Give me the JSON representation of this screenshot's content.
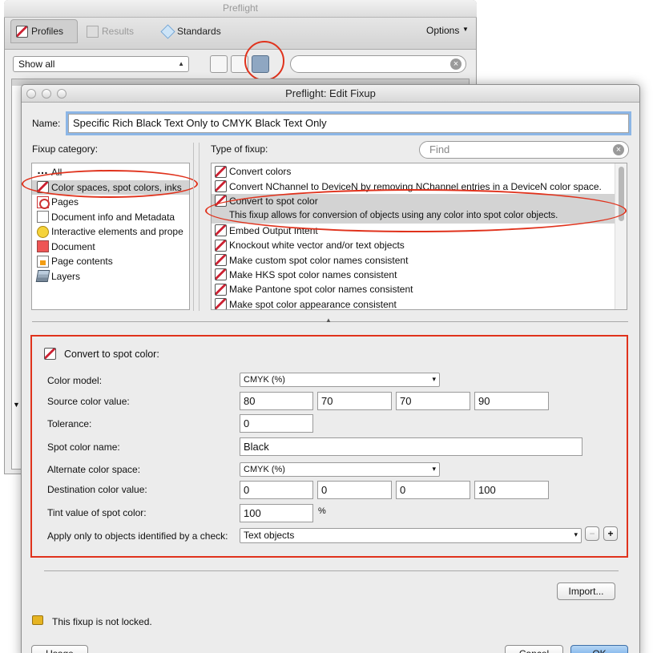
{
  "background_window": {
    "title": "Preflight",
    "tabs": [
      {
        "label": "Profiles",
        "icon": "profiles-icon",
        "selected": true
      },
      {
        "label": "Results",
        "icon": "results-icon",
        "selected": false
      },
      {
        "label": "Standards",
        "icon": "standards-icon",
        "selected": false
      }
    ],
    "options_label": "Options",
    "filter_select": "Show all",
    "search_value": ""
  },
  "dialog": {
    "title": "Preflight: Edit Fixup",
    "name_label": "Name:",
    "name_value": "Specific Rich Black Text Only to CMYK Black Text Only",
    "category_label": "Fixup category:",
    "categories": [
      {
        "label": "All",
        "icon": "dots-icon",
        "selected": false
      },
      {
        "label": "Color spaces, spot colors, inks",
        "icon": "color-wand-icon",
        "selected": true
      },
      {
        "label": "Pages",
        "icon": "pdf-icon",
        "selected": false
      },
      {
        "label": "Document info and Metadata",
        "icon": "info-icon",
        "selected": false
      },
      {
        "label": "Interactive elements and prope",
        "icon": "comment-icon",
        "selected": false
      },
      {
        "label": "Document",
        "icon": "document-icon",
        "selected": false
      },
      {
        "label": "Page contents",
        "icon": "page-icon",
        "selected": false
      },
      {
        "label": "Layers",
        "icon": "layers-icon",
        "selected": false
      }
    ],
    "type_label": "Type of fixup:",
    "find_placeholder": "Find",
    "fixups": [
      {
        "label": "Convert colors",
        "selected": false
      },
      {
        "label": "Convert NChannel to DeviceN by removing NChannel entries in a DeviceN color space.",
        "selected": false
      },
      {
        "label": "Convert to spot color",
        "selected": true
      },
      {
        "label": "This fixup allows for conversion of objects using any color into spot color objects.",
        "selected": true,
        "description": true
      },
      {
        "label": "Embed Output Intent",
        "selected": false
      },
      {
        "label": "Knockout white vector and/or text objects",
        "selected": false
      },
      {
        "label": "Make custom spot color names consistent",
        "selected": false
      },
      {
        "label": "Make HKS spot color names consistent",
        "selected": false
      },
      {
        "label": "Make Pantone spot color names consistent",
        "selected": false
      },
      {
        "label": "Make spot color appearance consistent",
        "selected": false
      }
    ],
    "settings": {
      "heading": "Convert to spot color:",
      "color_model_label": "Color model:",
      "color_model_value": "CMYK (%)",
      "source_label": "Source color value:",
      "source_values": [
        "80",
        "70",
        "70",
        "90"
      ],
      "tolerance_label": "Tolerance:",
      "tolerance_value": "0",
      "spot_name_label": "Spot color name:",
      "spot_name_value": "Black",
      "alt_space_label": "Alternate color space:",
      "alt_space_value": "CMYK (%)",
      "dest_label": "Destination color value:",
      "dest_values": [
        "0",
        "0",
        "0",
        "100"
      ],
      "tint_label": "Tint value of spot color:",
      "tint_value": "100",
      "tint_unit": "%",
      "apply_label": "Apply only to objects identified by a check:",
      "apply_value": "Text objects",
      "minus_label": "−",
      "plus_label": "+"
    },
    "import_label": "Import...",
    "lock_text": "This fixup is not locked.",
    "usage_label": "Usage",
    "cancel_label": "Cancel",
    "ok_label": "OK"
  },
  "annotation_color": "#e0321c"
}
